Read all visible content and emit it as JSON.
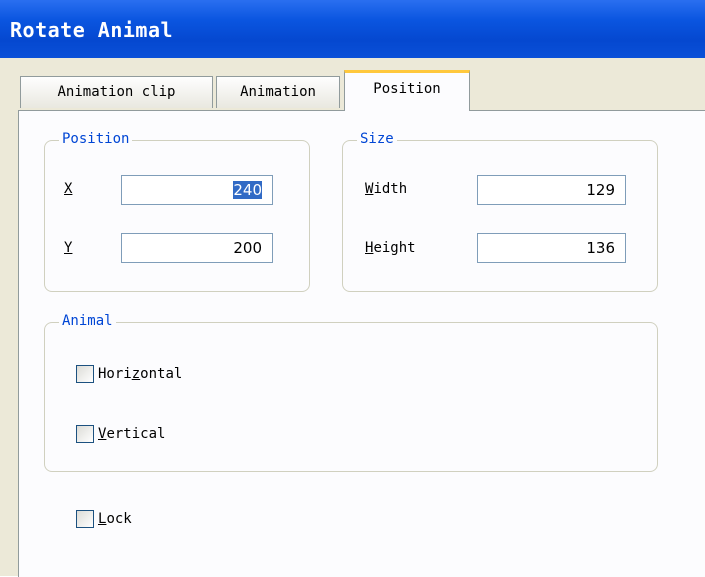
{
  "window": {
    "title": "Rotate Animal"
  },
  "tabs": [
    {
      "label": "Animation clip"
    },
    {
      "label": "Animation"
    },
    {
      "label": "Position"
    }
  ],
  "position_group": {
    "legend": "Position",
    "x": {
      "label": "X",
      "value": "240"
    },
    "y": {
      "label": "Y",
      "value": "200"
    }
  },
  "size_group": {
    "legend": "Size",
    "width": {
      "label_first": "W",
      "label_rest": "idth",
      "value": "129"
    },
    "height": {
      "label_first": "H",
      "label_rest": "eight",
      "value": "136"
    }
  },
  "animal_group": {
    "legend": "Animal",
    "horizontal": {
      "pre": "Hori",
      "u": "z",
      "post": "ontal",
      "checked": false
    },
    "vertical": {
      "pre": "",
      "u": "V",
      "post": "ertical",
      "checked": false
    }
  },
  "lock": {
    "pre": "",
    "u": "L",
    "post": "ock",
    "checked": false
  },
  "colors": {
    "titlebar": "#0a55e0",
    "accent_tab": "#ffc83c",
    "legend": "#0046d5"
  }
}
